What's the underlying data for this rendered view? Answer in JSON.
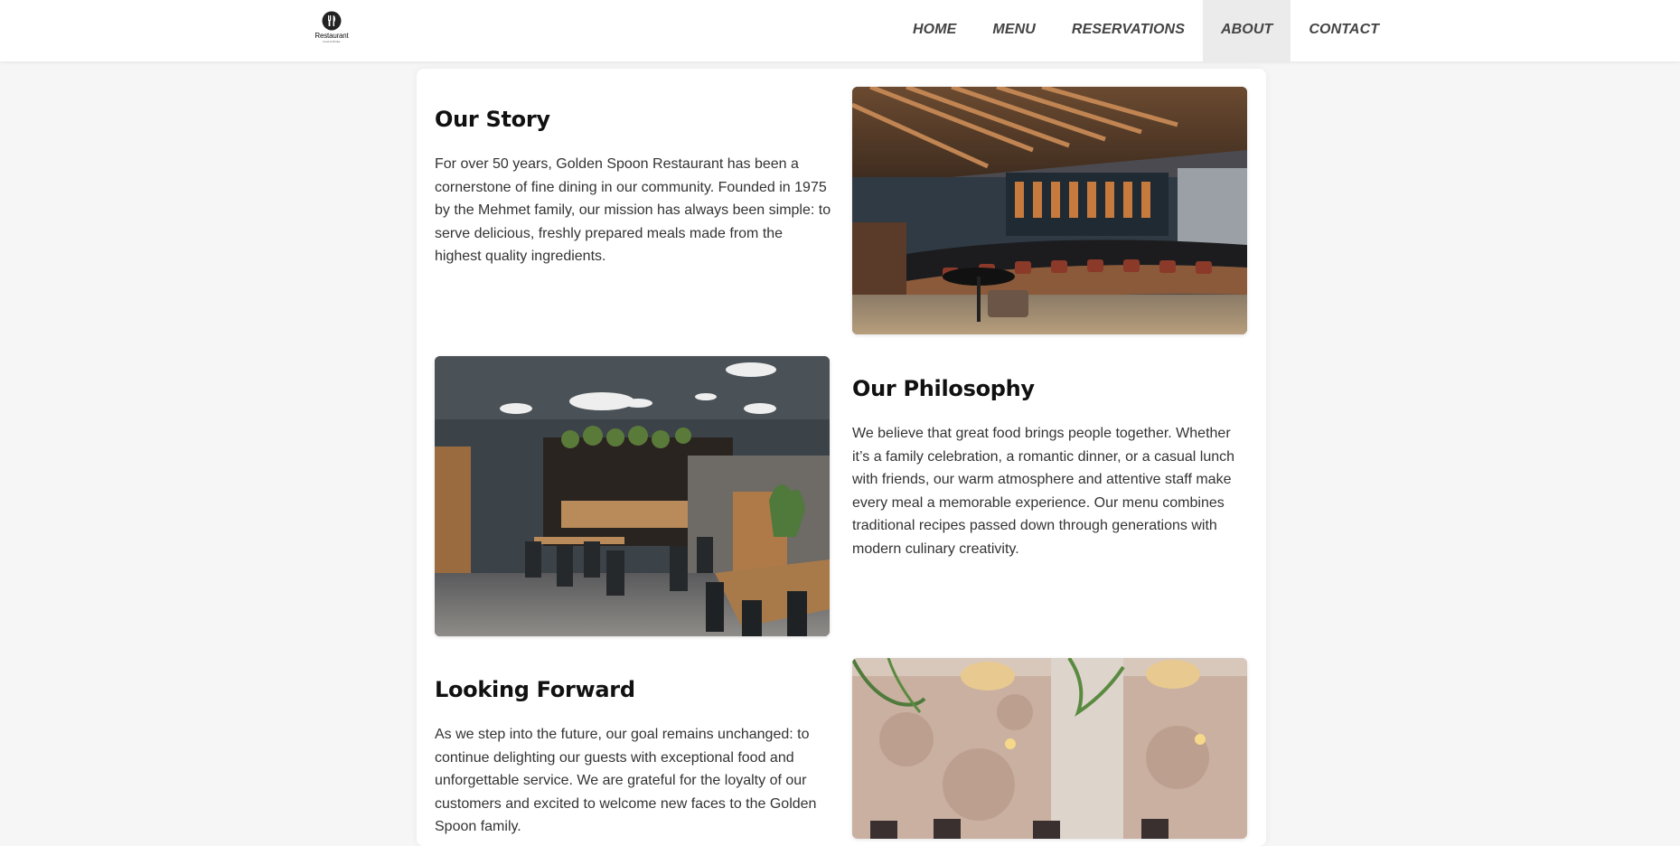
{
  "logo": {
    "text": "Restaurant",
    "subtext": "Food & Drinks"
  },
  "nav": {
    "items": [
      {
        "label": "HOME"
      },
      {
        "label": "MENU"
      },
      {
        "label": "RESERVATIONS"
      },
      {
        "label": "ABOUT",
        "active": true
      },
      {
        "label": "CONTACT"
      }
    ]
  },
  "sections": [
    {
      "heading": "Our Story",
      "text": "For over 50 years, Golden Spoon Restaurant has been a cornerstone of fine dining in our community. Founded in 1975 by the Mehmet family, our mission has always been simple: to serve delicious, freshly prepared meals made from the highest quality ingredients.",
      "image": "restaurant-bar-interior-photo"
    },
    {
      "heading": "Our Philosophy",
      "text": "We believe that great food brings people together. Whether it’s a family celebration, a romantic dinner, or a casual lunch with friends, our warm atmosphere and attentive staff make every meal a memorable experience. Our menu combines traditional recipes passed down through generations with modern culinary creativity.",
      "image": "dining-room-interior-photo"
    },
    {
      "heading": "Looking Forward",
      "text": "As we step into the future, our goal remains unchanged: to continue delighting our guests with exceptional food and unforgettable service. We are grateful for the loyalty of our customers and excited to welcome new faces to the Golden Spoon family.",
      "image": "rustic-cafe-interior-photo"
    }
  ],
  "colors": {
    "background": "#f6f6f6",
    "navbar": "#ffffff",
    "active_nav": "#ebebeb",
    "text": "#333333",
    "heading": "#111111"
  }
}
